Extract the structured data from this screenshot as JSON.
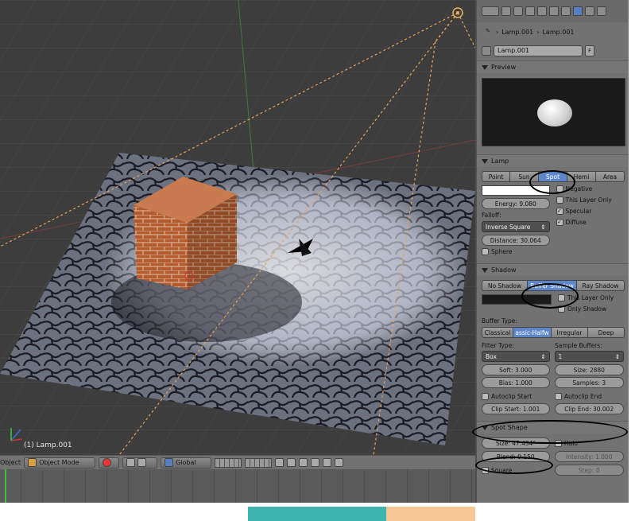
{
  "viewport": {
    "object_label": "(1) Lamp.001"
  },
  "header": {
    "menu_fragment": "Object",
    "mode": "Object Mode",
    "orientation": "Global"
  },
  "props": {
    "breadcrumb": [
      "Lamp.001",
      "Lamp.001"
    ],
    "name": "Lamp.001",
    "fake_user": "F",
    "preview_title": "Preview",
    "lamp": {
      "title": "Lamp",
      "types": [
        "Point",
        "Sun",
        "Spot",
        "Hemi",
        "Area"
      ],
      "active_type": "Spot",
      "color_hex": "#ffffff",
      "energy": "Energy: 9.080",
      "falloff_label": "Falloff:",
      "falloff": "Inverse Square",
      "distance": "Distance: 30.064",
      "sphere": "Sphere",
      "negative": "Negative",
      "this_layer_only": "This Layer Only",
      "specular": "Specular",
      "diffuse": "Diffuse"
    },
    "shadow": {
      "title": "Shadow",
      "modes": [
        "No Shadow",
        "Buffer Shadow",
        "Ray Shadow"
      ],
      "active_mode": "Buffer Shadow",
      "this_layer_only": "This Layer Only",
      "only_shadow": "Only Shadow",
      "buffer_type_label": "Buffer Type:",
      "buffer_types": [
        "Classical",
        "assic-Halfw",
        "Irregular",
        "Deep"
      ],
      "active_buffer": "assic-Halfw",
      "filter_type_label": "Filter Type:",
      "filter_type": "Box",
      "sample_buffers_label": "Sample Buffers:",
      "sample_buffers": "1",
      "soft": "Soft: 3.000",
      "size": "Size: 2880",
      "bias": "Bias: 1.000",
      "samples": "Samples: 3",
      "autoclip_start": "Autoclip Start",
      "autoclip_end": "Autoclip End",
      "clip_start": "Clip Start: 1.001",
      "clip_end": "Clip End: 30.002"
    },
    "spot_shape": {
      "title": "Spot Shape",
      "size": "Size: 47.434°",
      "halo": "Halo",
      "blend": "Blend: 0.150",
      "intensity": "Intensity: 1.000",
      "square": "Square",
      "step": "Step: 0"
    }
  },
  "colors": {
    "accent": "#5d87c9",
    "annotation_teal": "#3fb5b0",
    "annotation_peach": "#f7c896"
  }
}
